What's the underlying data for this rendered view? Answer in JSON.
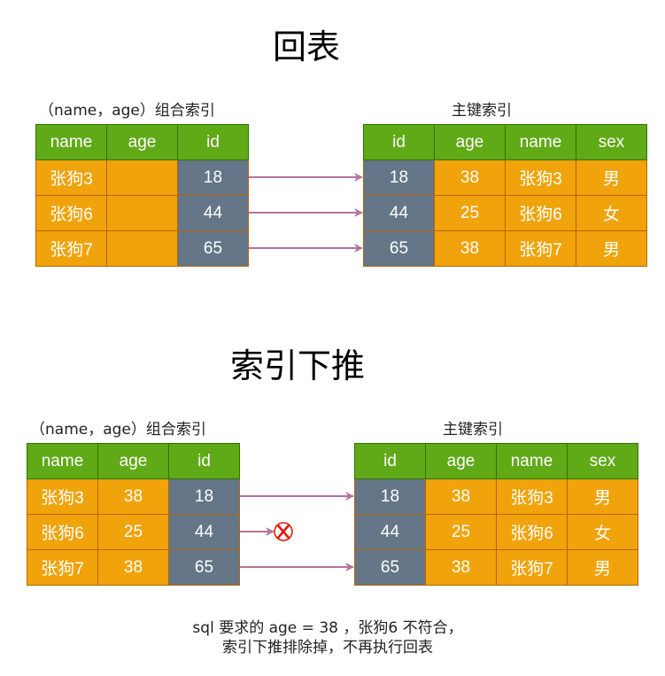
{
  "colors": {
    "header_green": "#60a917",
    "cell_orange": "#f0a30a",
    "cell_gray": "#647687",
    "arrow_purple": "#b5739d",
    "reject_red": "#e51400"
  },
  "section1": {
    "title": "回表",
    "left_table": {
      "label": "（name，age）组合索引",
      "headers": [
        "name",
        "age",
        "id"
      ],
      "rows": [
        [
          "张狗3",
          "",
          "18"
        ],
        [
          "张狗6",
          "",
          "44"
        ],
        [
          "张狗7",
          "",
          "65"
        ]
      ]
    },
    "right_table": {
      "label": "主键索引",
      "headers": [
        "id",
        "age",
        "name",
        "sex"
      ],
      "rows": [
        [
          "18",
          "38",
          "张狗3",
          "男"
        ],
        [
          "44",
          "25",
          "张狗6",
          "女"
        ],
        [
          "65",
          "38",
          "张狗7",
          "男"
        ]
      ]
    }
  },
  "section2": {
    "title": "索引下推",
    "left_table": {
      "label": "（name，age）组合索引",
      "headers": [
        "name",
        "age",
        "id"
      ],
      "rows": [
        [
          "张狗3",
          "38",
          "18"
        ],
        [
          "张狗6",
          "25",
          "44"
        ],
        [
          "张狗7",
          "38",
          "65"
        ]
      ]
    },
    "right_table": {
      "label": "主键索引",
      "headers": [
        "id",
        "age",
        "name",
        "sex"
      ],
      "rows": [
        [
          "18",
          "38",
          "张狗3",
          "男"
        ],
        [
          "44",
          "25",
          "张狗6",
          "女"
        ],
        [
          "65",
          "38",
          "张狗7",
          "男"
        ]
      ]
    },
    "reject_icon": "x-circle-icon",
    "note_line1": "sql 要求的 age = 38 ，张狗6 不符合，",
    "note_line2": "索引下推排除掉，不再执行回表"
  }
}
